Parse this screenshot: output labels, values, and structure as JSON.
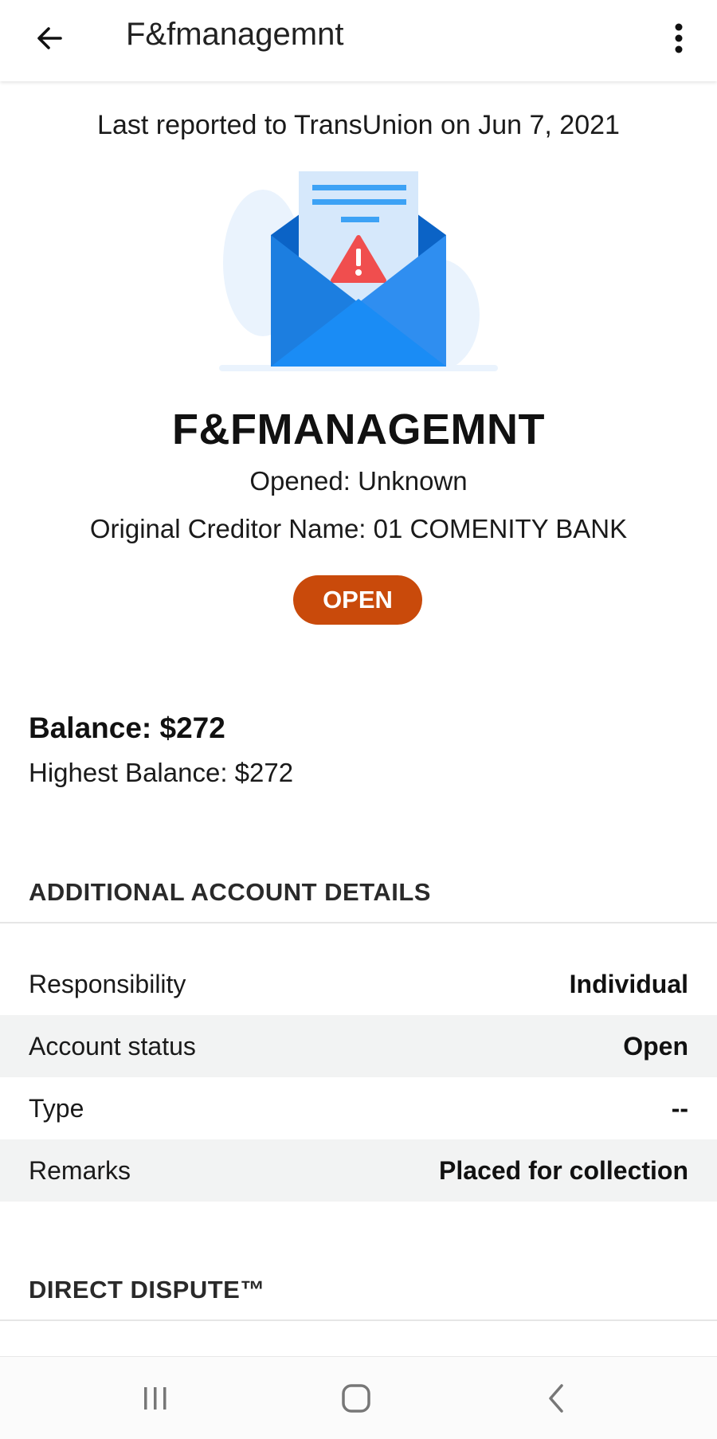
{
  "header": {
    "title": "F&fmanagemnt",
    "back_icon": "arrow-left-icon",
    "menu_icon": "more-vertical-icon"
  },
  "report": {
    "last_reported": "Last reported to TransUnion on Jun 7, 2021"
  },
  "account": {
    "name": "F&FMANAGEMNT",
    "opened": "Opened: Unknown",
    "original_creditor": "Original Creditor Name: 01 COMENITY BANK",
    "status_badge": "OPEN",
    "status_color": "#c94a0b"
  },
  "balance": {
    "balance": "Balance: $272",
    "highest_balance": "Highest Balance: $272"
  },
  "additional_details": {
    "title": "ADDITIONAL ACCOUNT DETAILS",
    "rows": [
      {
        "label": "Responsibility",
        "value": "Individual"
      },
      {
        "label": "Account status",
        "value": "Open"
      },
      {
        "label": "Type",
        "value": "--"
      },
      {
        "label": "Remarks",
        "value": "Placed for collection"
      }
    ]
  },
  "direct_dispute": {
    "title": "DIRECT DISPUTE™"
  },
  "system_nav": {
    "recents_icon": "recents-icon",
    "home_icon": "home-icon",
    "back_icon": "chevron-left-icon"
  }
}
